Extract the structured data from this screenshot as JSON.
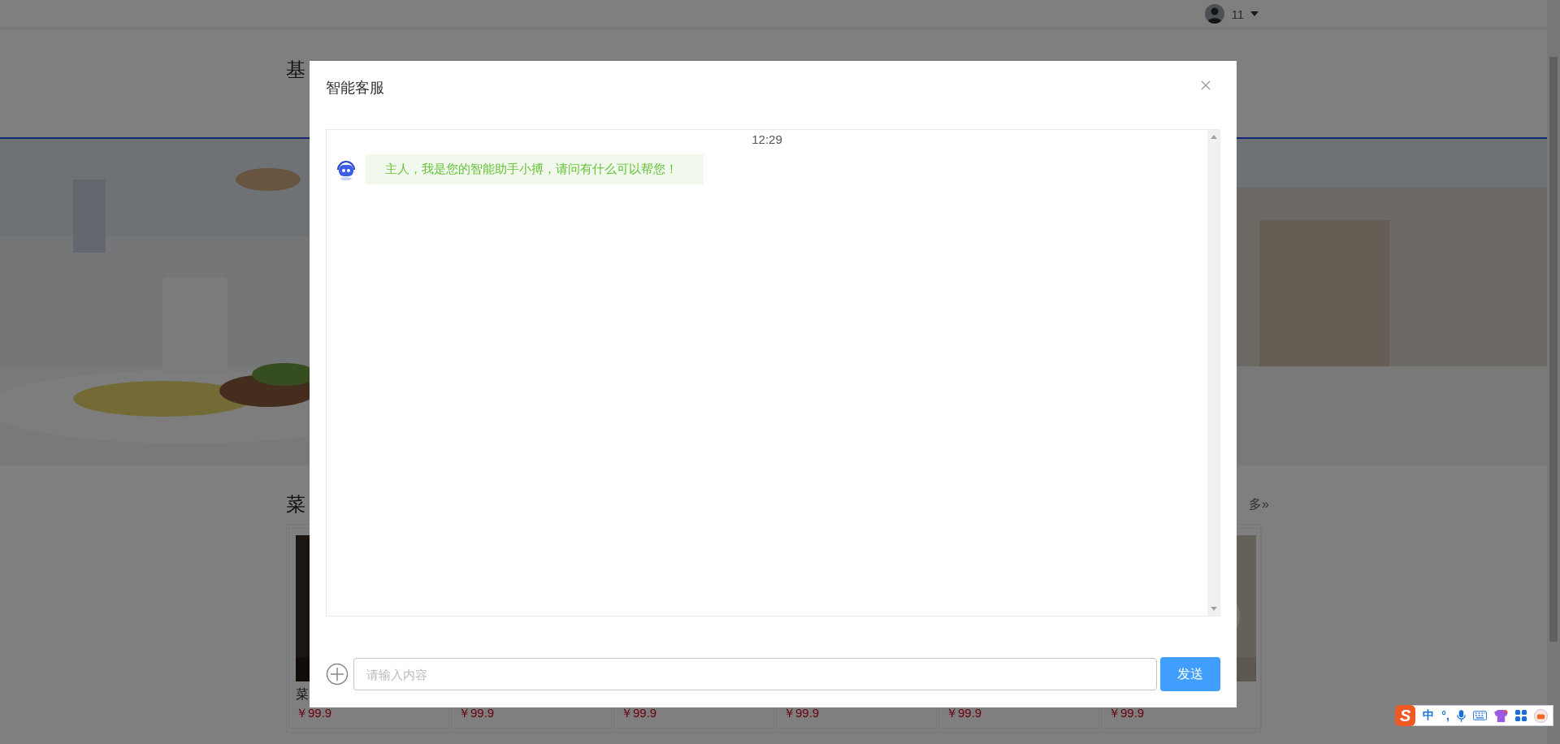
{
  "header": {
    "username": "11"
  },
  "site": {
    "title": "基"
  },
  "section": {
    "title": "菜",
    "more": "多»"
  },
  "products": [
    {
      "name": "菜",
      "price": "￥99.9",
      "kind": "picture"
    },
    {
      "price": "￥99.9"
    },
    {
      "price": "￥99.9"
    },
    {
      "price": "￥99.9"
    },
    {
      "price": "￥99.9"
    },
    {
      "price": "￥99.9",
      "kind": "picture"
    }
  ],
  "dialog": {
    "title": "智能客服",
    "messages": [
      {
        "kind": "time",
        "text": "12:29"
      },
      {
        "kind": "bot",
        "text": "主人，我是您的智能助手小搏，请问有什么可以帮您！"
      }
    ],
    "input": {
      "placeholder": "请输入内容"
    },
    "send": "发送"
  },
  "ime": {
    "logo": "S",
    "mode": "中",
    "punct": "°,"
  }
}
